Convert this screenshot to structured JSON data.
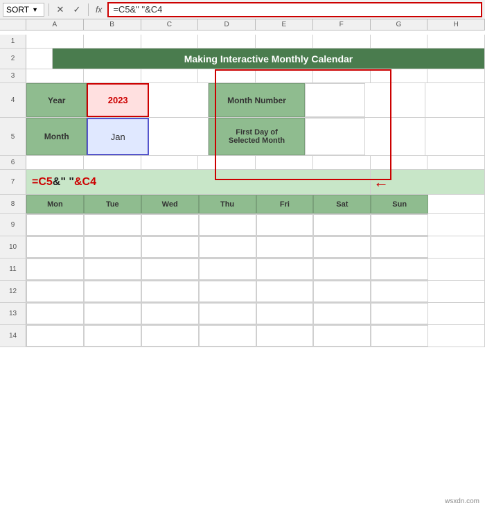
{
  "toolbar": {
    "sort_label": "SORT",
    "formula_content": "=C5&\" \"&C4",
    "formula_display_c5": "=C5",
    "formula_display_mid": "& \" \"",
    "formula_display_c4": "&C4"
  },
  "col_headers": [
    "A",
    "B",
    "C",
    "D",
    "E",
    "F",
    "G",
    "H"
  ],
  "row_numbers": [
    "1",
    "2",
    "3",
    "4",
    "5",
    "6",
    "7",
    "8",
    "9",
    "10",
    "11",
    "12",
    "13",
    "14"
  ],
  "title": "Making Interactive Monthly Calendar",
  "year_label": "Year",
  "year_value": "2023",
  "month_label": "Month",
  "month_value": "Jan",
  "month_number_label": "Month Number",
  "first_day_label": "First Day of\nSelected Month",
  "formula_row": {
    "c5_part": "=C5",
    "mid_part": "& \" \"",
    "c4_part": "&C4"
  },
  "days": [
    "Mon",
    "Tue",
    "Wed",
    "Thu",
    "Fri",
    "Sat",
    "Sun"
  ],
  "watermark": "wsxdn.com"
}
